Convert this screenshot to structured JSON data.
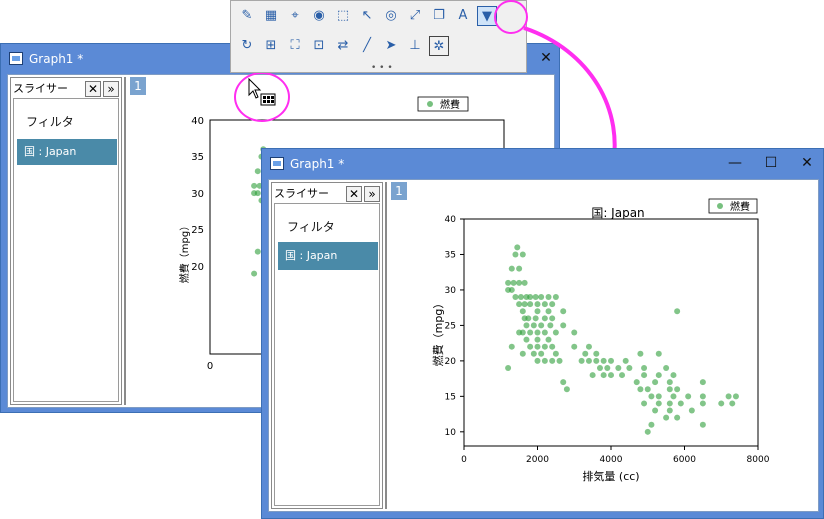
{
  "back_window": {
    "title": "Graph1 *",
    "close_glyph": "✕",
    "slicer": {
      "header": "スライサー",
      "close_glyph": "✕",
      "expand_glyph": "»",
      "filter_label": "フィルタ",
      "selected_item": "国 : Japan"
    },
    "layer_tab": "1",
    "legend": "燃費",
    "ylabel": "燃費（mpg）",
    "yticks": [
      "40",
      "35",
      "30",
      "25",
      "20"
    ],
    "xtick0": "0"
  },
  "front_window": {
    "title": "Graph1 *",
    "min_glyph": "—",
    "max_glyph": "☐",
    "close_glyph": "✕",
    "slicer": {
      "header": "スライサー",
      "close_glyph": "✕",
      "expand_glyph": "»",
      "filter_label": "フィルタ",
      "selected_item": "国 : Japan"
    },
    "layer_tab": "1"
  },
  "toolbar": {
    "grip": "• • •",
    "row1_icons": [
      "brush-icon",
      "grid-select-icon",
      "data-reader-icon",
      "mask-icon",
      "region-select-icon",
      "pointer-icon",
      "eye-icon",
      "rescale-icon",
      "copy-format-icon",
      "text-tool-icon",
      "filter-icon"
    ],
    "row2_icons": [
      "refresh-icon",
      "layer-grid-icon",
      "fit-page-icon",
      "insert-layer-icon",
      "swap-icon",
      "draw-line-icon",
      "arrow-icon",
      "axis-icon",
      "settings-icon"
    ],
    "accent": "#ff2ef0"
  },
  "chart_data": {
    "type": "scatter",
    "title": "国: Japan",
    "xlabel": "排気量 (cc)",
    "ylabel": "燃費（mpg）",
    "xlim": [
      0,
      8000
    ],
    "ylim": [
      8,
      40
    ],
    "xticks": [
      0,
      2000,
      4000,
      6000,
      8000
    ],
    "yticks": [
      10,
      15,
      20,
      25,
      30,
      35,
      40
    ],
    "legend_position": "top-right",
    "marker_color": "#2e9e3b",
    "series": [
      {
        "name": "燃費",
        "points": [
          [
            1450,
            36
          ],
          [
            1400,
            35
          ],
          [
            1600,
            35
          ],
          [
            1300,
            33
          ],
          [
            1500,
            33
          ],
          [
            1200,
            31
          ],
          [
            1350,
            31
          ],
          [
            1500,
            31
          ],
          [
            1650,
            31
          ],
          [
            1200,
            30
          ],
          [
            1300,
            30
          ],
          [
            1400,
            29
          ],
          [
            1550,
            29
          ],
          [
            1700,
            29
          ],
          [
            1800,
            29
          ],
          [
            1950,
            29
          ],
          [
            2100,
            29
          ],
          [
            2300,
            29
          ],
          [
            2500,
            29
          ],
          [
            1500,
            28
          ],
          [
            1650,
            28
          ],
          [
            1800,
            28
          ],
          [
            2000,
            28
          ],
          [
            2200,
            28
          ],
          [
            2400,
            28
          ],
          [
            1600,
            27
          ],
          [
            2000,
            27
          ],
          [
            2300,
            27
          ],
          [
            2700,
            27
          ],
          [
            1650,
            26
          ],
          [
            1750,
            26
          ],
          [
            1950,
            26
          ],
          [
            2200,
            26
          ],
          [
            2400,
            26
          ],
          [
            1700,
            25
          ],
          [
            1900,
            25
          ],
          [
            2100,
            25
          ],
          [
            2350,
            25
          ],
          [
            2700,
            25
          ],
          [
            1500,
            24
          ],
          [
            1600,
            24
          ],
          [
            1800,
            24
          ],
          [
            2000,
            24
          ],
          [
            2200,
            24
          ],
          [
            2500,
            24
          ],
          [
            3000,
            24
          ],
          [
            1700,
            23
          ],
          [
            2000,
            23
          ],
          [
            2300,
            23
          ],
          [
            1300,
            22
          ],
          [
            1800,
            22
          ],
          [
            2000,
            22
          ],
          [
            2200,
            22
          ],
          [
            2400,
            22
          ],
          [
            3000,
            22
          ],
          [
            3400,
            22
          ],
          [
            1600,
            21
          ],
          [
            1900,
            21
          ],
          [
            2100,
            21
          ],
          [
            2500,
            21
          ],
          [
            3300,
            21
          ],
          [
            3600,
            21
          ],
          [
            1200,
            19
          ],
          [
            2000,
            20
          ],
          [
            2200,
            20
          ],
          [
            2400,
            20
          ],
          [
            2600,
            20
          ],
          [
            3200,
            20
          ],
          [
            3400,
            20
          ],
          [
            3600,
            20
          ],
          [
            3800,
            20
          ],
          [
            4000,
            20
          ],
          [
            4400,
            20
          ],
          [
            4800,
            21
          ],
          [
            5300,
            21
          ],
          [
            3700,
            19
          ],
          [
            3900,
            19
          ],
          [
            4200,
            19
          ],
          [
            4500,
            19
          ],
          [
            4900,
            19
          ],
          [
            5500,
            19
          ],
          [
            3500,
            18
          ],
          [
            3800,
            18
          ],
          [
            4000,
            18
          ],
          [
            4300,
            18
          ],
          [
            4900,
            18
          ],
          [
            5300,
            18
          ],
          [
            5700,
            18
          ],
          [
            2700,
            17
          ],
          [
            2800,
            16
          ],
          [
            4700,
            17
          ],
          [
            5200,
            17
          ],
          [
            5600,
            17
          ],
          [
            6500,
            17
          ],
          [
            4800,
            16
          ],
          [
            5000,
            16
          ],
          [
            5600,
            16
          ],
          [
            5800,
            16
          ],
          [
            5100,
            15
          ],
          [
            5300,
            15
          ],
          [
            5700,
            15
          ],
          [
            6100,
            15
          ],
          [
            6500,
            15
          ],
          [
            7200,
            15
          ],
          [
            7400,
            15
          ],
          [
            4900,
            14
          ],
          [
            5300,
            14
          ],
          [
            5600,
            14
          ],
          [
            5900,
            14
          ],
          [
            6500,
            14
          ],
          [
            7000,
            14
          ],
          [
            7300,
            14
          ],
          [
            5200,
            13
          ],
          [
            5600,
            13
          ],
          [
            6200,
            13
          ],
          [
            5500,
            12
          ],
          [
            5800,
            12
          ],
          [
            5100,
            11
          ],
          [
            6500,
            11
          ],
          [
            5000,
            10
          ],
          [
            5800,
            27
          ]
        ]
      }
    ]
  }
}
